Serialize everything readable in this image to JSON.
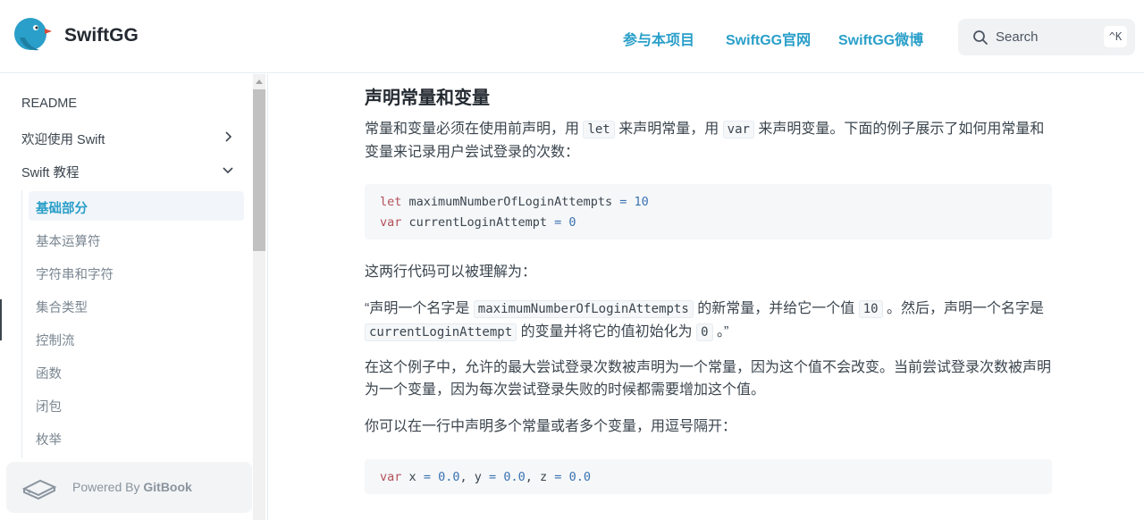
{
  "header": {
    "brand": "SwiftGG",
    "nav": [
      "参与本项目",
      "SwiftGG官网",
      "SwiftGG微博"
    ],
    "search": {
      "placeholder": "Search",
      "shortcut": "^K"
    }
  },
  "sidebar": {
    "items": [
      {
        "label": "README"
      },
      {
        "label": "欢迎使用 Swift"
      },
      {
        "label": "Swift 教程"
      }
    ],
    "sub_items": [
      "基础部分",
      "基本运算符",
      "字符串和字符",
      "集合类型",
      "控制流",
      "函数",
      "闭包",
      "枚举"
    ],
    "active_sub": "基础部分",
    "powered": {
      "prefix": "Powered By ",
      "brand": "GitBook"
    }
  },
  "main": {
    "heading": "声明常量和变量",
    "p1": {
      "a": "常量和变量必须在使用前声明，用 ",
      "code1": "let",
      "b": " 来声明常量，用 ",
      "code2": "var",
      "c": " 来声明变量。下面的例子展示了如何用常量和变量来记录用户尝试登录的次数："
    },
    "code1": {
      "line1": {
        "kw": "let",
        "name": "maximumNumberOfLoginAttempts",
        "op": "=",
        "value": "10"
      },
      "line2": {
        "kw": "var",
        "name": "currentLoginAttempt",
        "op": "=",
        "value": "0"
      }
    },
    "p2": "这两行代码可以被理解为：",
    "p3": {
      "a": "“声明一个名字是 ",
      "code1": "maximumNumberOfLoginAttempts",
      "b": " 的新常量，并给它一个值 ",
      "code2": "10",
      "c": " 。然后，声明一个名字是 ",
      "code3": "currentLoginAttempt",
      "d": " 的变量并将它的值初始化为 ",
      "code4": "0",
      "e": " 。”"
    },
    "p4": "在这个例子中，允许的最大尝试登录次数被声明为一个常量，因为这个值不会改变。当前尝试登录次数被声明为一个变量，因为每次尝试登录失败的时候都需要增加这个值。",
    "p5": "你可以在一行中声明多个常量或者多个变量，用逗号隔开：",
    "code2": {
      "kw": "var",
      "x": "x",
      "xv": "0.0",
      "y": "y",
      "yv": "0.0",
      "z": "z",
      "zv": "0.0",
      "op": "=",
      "comma": ","
    }
  },
  "colors": {
    "accent": "#2a9fc9",
    "keyword": "#b5505a",
    "number": "#3a72b0"
  }
}
